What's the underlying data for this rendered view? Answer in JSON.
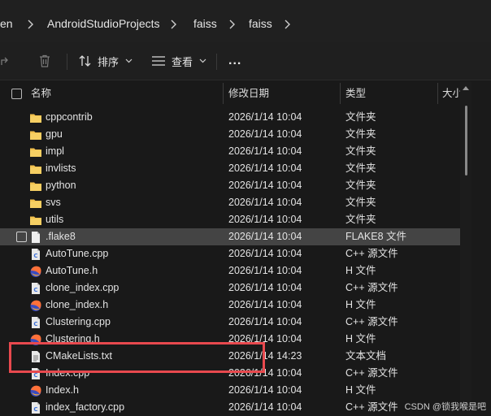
{
  "breadcrumb": {
    "items": [
      "en",
      "AndroidStudioProjects",
      "faiss",
      "faiss"
    ]
  },
  "toolbar": {
    "sort_label": "排序",
    "view_label": "查看",
    "more_label": "..."
  },
  "columns": {
    "name": "名称",
    "modified": "修改日期",
    "type": "类型",
    "size": "大小"
  },
  "rows": [
    {
      "name": "cppcontrib",
      "date": "2026/1/14 10:04",
      "type": "文件夹",
      "icon": "folder-icon"
    },
    {
      "name": "gpu",
      "date": "2026/1/14 10:04",
      "type": "文件夹",
      "icon": "folder-icon"
    },
    {
      "name": "impl",
      "date": "2026/1/14 10:04",
      "type": "文件夹",
      "icon": "folder-icon"
    },
    {
      "name": "invlists",
      "date": "2026/1/14 10:04",
      "type": "文件夹",
      "icon": "folder-icon"
    },
    {
      "name": "python",
      "date": "2026/1/14 10:04",
      "type": "文件夹",
      "icon": "folder-icon"
    },
    {
      "name": "svs",
      "date": "2026/1/14 10:04",
      "type": "文件夹",
      "icon": "folder-icon"
    },
    {
      "name": "utils",
      "date": "2026/1/14 10:04",
      "type": "文件夹",
      "icon": "folder-icon"
    },
    {
      "name": ".flake8",
      "date": "2026/1/14 10:04",
      "type": "FLAKE8 文件",
      "icon": "blank-file-icon",
      "selected": true
    },
    {
      "name": "AutoTune.cpp",
      "date": "2026/1/14 10:04",
      "type": "C++ 源文件",
      "icon": "cpp-file-icon"
    },
    {
      "name": "AutoTune.h",
      "date": "2026/1/14 10:04",
      "type": "H 文件",
      "icon": "header-file-icon"
    },
    {
      "name": "clone_index.cpp",
      "date": "2026/1/14 10:04",
      "type": "C++ 源文件",
      "icon": "cpp-file-icon"
    },
    {
      "name": "clone_index.h",
      "date": "2026/1/14 10:04",
      "type": "H 文件",
      "icon": "header-file-icon"
    },
    {
      "name": "Clustering.cpp",
      "date": "2026/1/14 10:04",
      "type": "C++ 源文件",
      "icon": "cpp-file-icon"
    },
    {
      "name": "Clustering.h",
      "date": "2026/1/14 10:04",
      "type": "H 文件",
      "icon": "header-file-icon"
    },
    {
      "name": "CMakeLists.txt",
      "date": "2026/1/14 14:23",
      "type": "文本文档",
      "icon": "text-file-icon"
    },
    {
      "name": "Index.cpp",
      "date": "2026/1/14 10:04",
      "type": "C++ 源文件",
      "icon": "cpp-file-icon"
    },
    {
      "name": "Index.h",
      "date": "2026/1/14 10:04",
      "type": "H 文件",
      "icon": "header-file-icon"
    },
    {
      "name": "index_factory.cpp",
      "date": "2026/1/14 10:04",
      "type": "C++ 源文件",
      "icon": "cpp-file-icon"
    }
  ],
  "watermark": "CSDN @锁我喉是吧",
  "colors": {
    "folder": "#f2c14e",
    "selection": "#444444",
    "annotation": "#e8494e"
  }
}
